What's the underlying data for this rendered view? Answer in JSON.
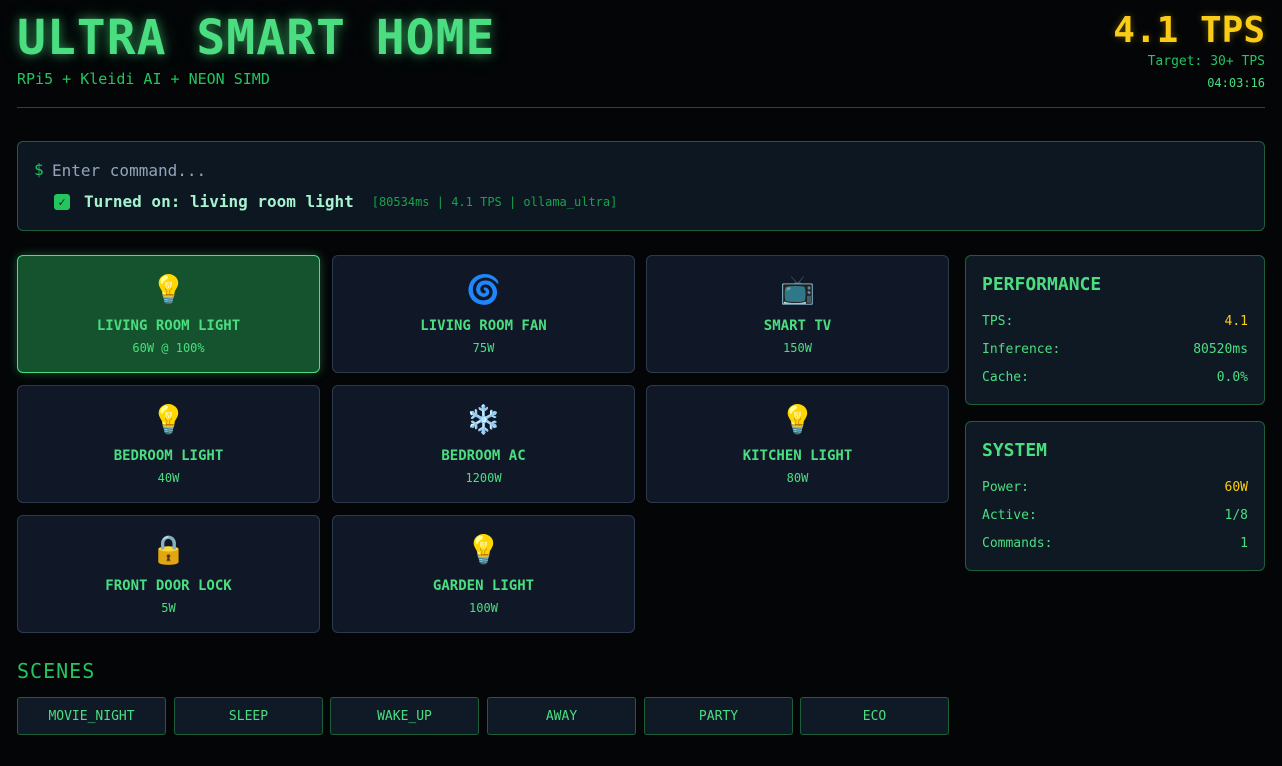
{
  "header": {
    "title": "ULTRA SMART HOME",
    "subtitle": "RPi5 + Kleidi AI + NEON SIMD",
    "tps": "4.1 TPS",
    "target": "Target: 30+ TPS",
    "clock": "04:03:16"
  },
  "command": {
    "prompt": "$",
    "placeholder": "Enter command...",
    "result_icon": "check-icon",
    "result_text": "Turned on: living room light",
    "result_meta": "[80534ms | 4.1 TPS | ollama_ultra]"
  },
  "devices": [
    {
      "name": "LIVING ROOM LIGHT",
      "power": "60W  @ 100%",
      "icon": "💡",
      "icon_name": "lightbulb-icon",
      "on": true
    },
    {
      "name": "LIVING ROOM FAN",
      "power": "75W",
      "icon": "🌀",
      "icon_name": "fan-icon",
      "on": false
    },
    {
      "name": "SMART TV",
      "power": "150W",
      "icon": "📺",
      "icon_name": "tv-icon",
      "on": false
    },
    {
      "name": "BEDROOM LIGHT",
      "power": "40W",
      "icon": "💡",
      "icon_name": "lightbulb-icon",
      "on": false
    },
    {
      "name": "BEDROOM AC",
      "power": "1200W",
      "icon": "❄️",
      "icon_name": "snowflake-icon",
      "on": false
    },
    {
      "name": "KITCHEN LIGHT",
      "power": "80W",
      "icon": "💡",
      "icon_name": "lightbulb-icon",
      "on": false
    },
    {
      "name": "FRONT DOOR LOCK",
      "power": "5W",
      "icon": "🔒",
      "icon_name": "lock-icon",
      "on": false
    },
    {
      "name": "GARDEN LIGHT",
      "power": "100W",
      "icon": "💡",
      "icon_name": "lightbulb-icon",
      "on": false
    }
  ],
  "performance": {
    "title": "PERFORMANCE",
    "rows": [
      {
        "label": "TPS:",
        "value": "4.1",
        "highlight": true
      },
      {
        "label": "Inference:",
        "value": "80520ms",
        "highlight": false
      },
      {
        "label": "Cache:",
        "value": "0.0%",
        "highlight": false
      }
    ]
  },
  "system": {
    "title": "SYSTEM",
    "rows": [
      {
        "label": "Power:",
        "value": "60W",
        "highlight": true
      },
      {
        "label": "Active:",
        "value": "1/8",
        "highlight": false
      },
      {
        "label": "Commands:",
        "value": "1",
        "highlight": false
      }
    ]
  },
  "scenes": {
    "title": "SCENES",
    "items": [
      "MOVIE_NIGHT",
      "SLEEP",
      "WAKE_UP",
      "AWAY",
      "PARTY",
      "ECO"
    ]
  },
  "colors": {
    "accent": "#4ade80",
    "highlight": "#facc15",
    "background": "#030507",
    "card": "#101827",
    "card_active": "#14532d"
  }
}
